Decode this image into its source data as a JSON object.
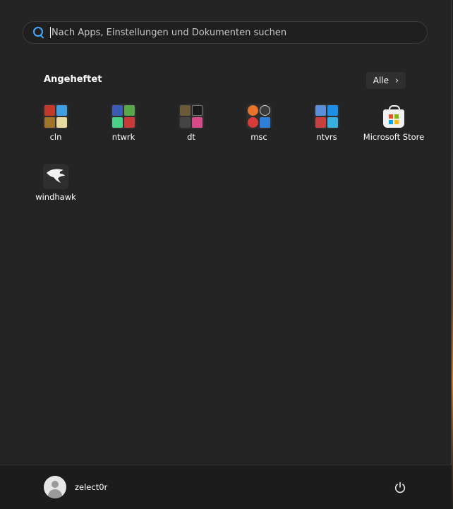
{
  "search": {
    "placeholder": "Nach Apps, Einstellungen und Dokumenten suchen"
  },
  "pinned": {
    "title": "Angeheftet",
    "all_label": "Alle",
    "apps": [
      {
        "label": "cln",
        "icon": "folder-group-icon"
      },
      {
        "label": "ntwrk",
        "icon": "folder-group-icon"
      },
      {
        "label": "dt",
        "icon": "folder-group-icon"
      },
      {
        "label": "msc",
        "icon": "folder-group-icon"
      },
      {
        "label": "ntvrs",
        "icon": "folder-group-icon"
      },
      {
        "label": "Microsoft Store",
        "icon": "microsoft-store-icon"
      },
      {
        "label": "windhawk",
        "icon": "windhawk-eagle-icon"
      }
    ]
  },
  "footer": {
    "user_name": "zelect0r",
    "power_icon": "power-icon"
  },
  "colors": {
    "accent": "#4aa8ff",
    "background": "#242424",
    "footer": "#1c1c1c"
  }
}
